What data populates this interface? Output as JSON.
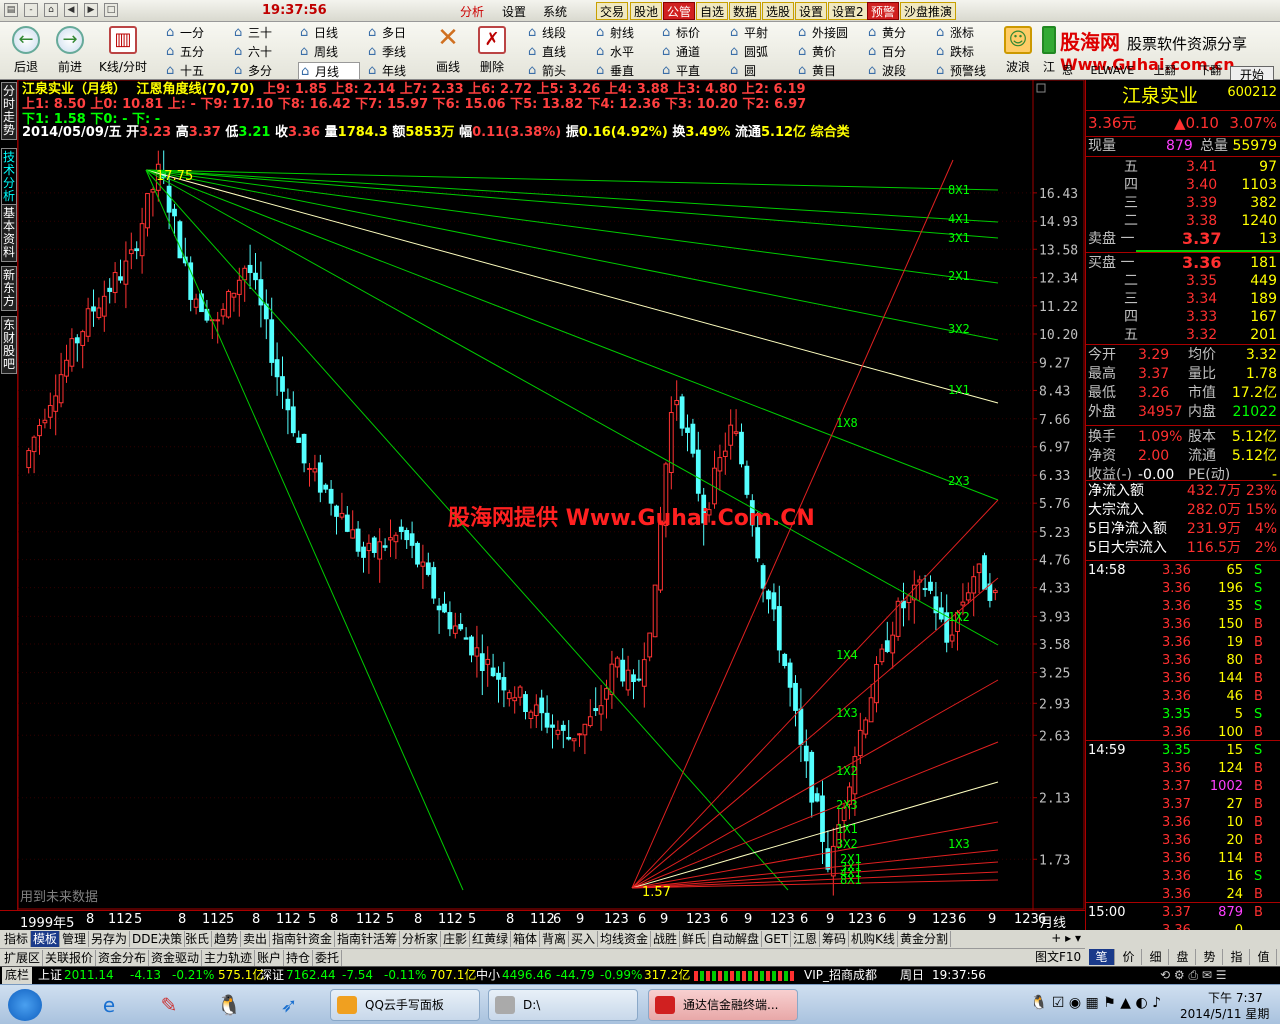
{
  "titlebar": {
    "clock": "19:37:56",
    "menus": [
      "分析",
      "设置",
      "系统"
    ],
    "buttons": [
      "交易",
      "股池",
      "公管",
      "自选",
      "数据",
      "选股",
      "设置",
      "设置2",
      "预警",
      "沙盘推演"
    ]
  },
  "toolbar": {
    "back": "后退",
    "forward": "前进",
    "kline": "K线/分时",
    "periods": [
      [
        "一分",
        "三十",
        "日线",
        "多日"
      ],
      [
        "五分",
        "六十",
        "周线",
        "季线"
      ],
      [
        "十五",
        "多分",
        "月线",
        "年线"
      ]
    ],
    "draw": "画线",
    "delete": "删除",
    "tools": [
      [
        "线段",
        "射线",
        "标价",
        "平射",
        "外接圆",
        "黄分",
        "涨标"
      ],
      [
        "直线",
        "水平",
        "通道",
        "圆弧",
        "黄价",
        "百分",
        "跌标"
      ],
      [
        "箭头",
        "垂直",
        "平直",
        "圆",
        "黄目",
        "波段",
        "预警线"
      ]
    ],
    "extra": [
      "波浪",
      "江",
      "恩",
      "ELWAVE",
      "上翻",
      "下翻"
    ],
    "logo_cn": "股海网",
    "logo_sub": "股票软件资源分享",
    "logo_url": "Www.Guhai.com.cn",
    "start": "开始"
  },
  "left_tabs": [
    "分时走势",
    "技术分析",
    "基本资料",
    "新东方",
    "东财股吧"
  ],
  "chart": {
    "title": "江泉实业（月线）",
    "indicator": "江恩角度线(70,70)",
    "up_line": "上9: 1.85 上8: 2.14 上7: 2.33 上6: 2.72 上5: 3.26 上4: 3.88 上3: 4.80 上2: 6.19",
    "line2": "上1: 8.50 上0: 10.81 上: - 下9: 17.10 下8: 16.42 下7: 15.97 下6: 15.06 下5: 13.82 下4: 12.36 下3: 10.20 下2: 6.97",
    "line3": "下1: 1.58 下0: - 下: -",
    "date": "2014/05/09/五",
    "ohlc": {
      "open_label": "开",
      "open": "3.23",
      "high_label": "高",
      "high": "3.37",
      "low_label": "低",
      "low": "3.21",
      "close_label": "收",
      "close": "3.36",
      "vol_label": "量",
      "vol": "1784.3",
      "amt_label": "额",
      "amt": "5853万",
      "chg_label": "幅",
      "chg": "0.11(3.38%)",
      "amp_label": "振",
      "amp": "0.16(4.92%)",
      "turn_label": "换",
      "turn": "3.49%",
      "float_label": "流通",
      "float": "5.12亿",
      "cat": "综合类"
    },
    "peak_label": "17.75",
    "low_label": "1.57",
    "watermark": "股海网提供 Www.Guhai.Com.CN",
    "future_note": "用到未来数据",
    "period_label": "月线",
    "y_ticks": [
      "16.43",
      "14.93",
      "13.58",
      "12.34",
      "11.22",
      "10.20",
      "9.27",
      "8.43",
      "7.66",
      "6.97",
      "6.33",
      "5.76",
      "5.23",
      "4.76",
      "4.33",
      "3.93",
      "3.58",
      "3.25",
      "2.93",
      "2.63",
      "2.13",
      "1.73"
    ],
    "x_ticks": [
      "1999年5",
      "8",
      "112",
      "5",
      "8",
      "112",
      "5",
      "8",
      "112",
      "5",
      "8",
      "112",
      "5",
      "8",
      "112",
      "5",
      "8",
      "112",
      "6",
      "9",
      "123",
      "6",
      "9",
      "123",
      "6",
      "9",
      "123",
      "6",
      "9",
      "123",
      "6",
      "9",
      "123",
      "6",
      "9",
      "123",
      "6",
      "9",
      "123"
    ],
    "fan_top_labels": [
      "8X1",
      "4X1",
      "3X1",
      "2X1",
      "3X2",
      "1X1",
      "2X3",
      "1X2"
    ],
    "fan_bottom_labels": [
      "1X8",
      "1X4",
      "1X3",
      "1X2",
      "2X3",
      "1X1",
      "3X2",
      "2X1",
      "3X1",
      "4X1",
      "8X1",
      "1X3"
    ]
  },
  "chart_data": {
    "type": "candlestick",
    "title": "江泉实业（月线）",
    "scale": "log",
    "ylim": [
      1.57,
      17.75
    ],
    "peak": 17.75,
    "trough": 1.57,
    "last": {
      "date": "2014/05/09",
      "open": 3.23,
      "high": 3.37,
      "low": 3.21,
      "close": 3.36
    }
  },
  "rpanel": {
    "name": "江泉实业",
    "code": "600212",
    "price": "3.36元",
    "chg": "▲0.10",
    "pct": "3.07%",
    "cur_label": "现量",
    "cur_vol": "879",
    "total_label": "总量",
    "total": "55979",
    "asks": [
      [
        "五",
        "3.41",
        "97"
      ],
      [
        "四",
        "3.40",
        "1103"
      ],
      [
        "三",
        "3.39",
        "382"
      ],
      [
        "二",
        "3.38",
        "1240"
      ],
      [
        "卖盘 一",
        "3.37",
        "13"
      ]
    ],
    "bids": [
      [
        "买盘 一",
        "3.36",
        "181"
      ],
      [
        "二",
        "3.35",
        "449"
      ],
      [
        "三",
        "3.34",
        "189"
      ],
      [
        "四",
        "3.33",
        "167"
      ],
      [
        "五",
        "3.32",
        "201"
      ]
    ],
    "stats": [
      [
        "今开",
        "3.29",
        "均价",
        "3.32"
      ],
      [
        "最高",
        "3.37",
        "量比",
        "1.78"
      ],
      [
        "最低",
        "3.26",
        "市值",
        "17.2亿"
      ],
      [
        "外盘",
        "34957",
        "内盘",
        "21022"
      ],
      [
        "换手",
        "1.09%",
        "股本",
        "5.12亿"
      ],
      [
        "净资",
        "2.00",
        "流通",
        "5.12亿"
      ],
      [
        "收益(-)",
        "-0.00",
        "PE(动)",
        "-"
      ]
    ],
    "flows": [
      [
        "净流入额",
        "432.7万",
        "23%"
      ],
      [
        "大宗流入",
        "282.0万",
        "15%"
      ],
      [
        "5日净流入额",
        "231.9万",
        "4%"
      ],
      [
        "5日大宗流入",
        "116.5万",
        "2%"
      ]
    ],
    "ticks": [
      [
        "14:58",
        "3.36",
        "65",
        "S"
      ],
      [
        "",
        "3.36",
        "196",
        "S"
      ],
      [
        "",
        "3.36",
        "35",
        "S"
      ],
      [
        "",
        "3.36",
        "150",
        "B"
      ],
      [
        "",
        "3.36",
        "19",
        "B"
      ],
      [
        "",
        "3.36",
        "80",
        "B"
      ],
      [
        "",
        "3.36",
        "144",
        "B"
      ],
      [
        "",
        "3.36",
        "46",
        "B"
      ],
      [
        "",
        "3.35",
        "5",
        "S"
      ],
      [
        "",
        "3.36",
        "100",
        "B"
      ],
      [
        "14:59",
        "3.35",
        "15",
        "S"
      ],
      [
        "",
        "3.36",
        "124",
        "B"
      ],
      [
        "",
        "3.37",
        "1002",
        "B"
      ],
      [
        "",
        "3.37",
        "27",
        "B"
      ],
      [
        "",
        "3.36",
        "10",
        "B"
      ],
      [
        "",
        "3.36",
        "20",
        "B"
      ],
      [
        "",
        "3.36",
        "114",
        "B"
      ],
      [
        "",
        "3.36",
        "16",
        "S"
      ],
      [
        "",
        "3.36",
        "24",
        "B"
      ],
      [
        "15:00",
        "3.37",
        "879",
        "B"
      ],
      [
        "",
        "3.36",
        "0",
        ""
      ]
    ],
    "btabs": [
      "笔",
      "价",
      "细",
      "盘",
      "势",
      "指",
      "值"
    ],
    "graph_btn": "图文F10"
  },
  "bottom_tabs1": [
    "指标",
    "模板",
    "管理",
    "另存为",
    "DDE决策",
    "张氏",
    "趋势",
    "卖出",
    "指南针资金",
    "指南针活筹",
    "分析家",
    "庄影",
    "红黄绿",
    "箱体",
    "背离",
    "买入",
    "均线资金",
    "战胜",
    "鲜氏",
    "自动解盘",
    "GET",
    "江恩",
    "筹码",
    "机购K线",
    "黄金分割"
  ],
  "bottom_tabs2": [
    "扩展区",
    "关联报价",
    "资金分布",
    "资金驱动",
    "主力轨迹",
    "账户",
    "持仓",
    "委托"
  ],
  "status": {
    "sh_label": "上证",
    "sh": "2011.14",
    "sh_chg": "-4.13",
    "sh_pct": "-0.21%",
    "sh_amt": "575.1亿",
    "sz_label": "深证",
    "sz": "7162.44",
    "sz_chg": "-7.54",
    "sz_pct": "-0.11%",
    "sz_amt": "707.1亿",
    "zx_label": "中小",
    "zx": "4496.46",
    "zx_chg": "-44.79",
    "zx_pct": "-0.99%",
    "zx_amt": "317.2亿",
    "vip": "VIP_招商成都",
    "week": "周日",
    "time": "19:37:56",
    "ticker": "底栏"
  },
  "taskbar": {
    "win1": "QQ云手写面板",
    "win2": "D:\\",
    "win3": "通达信金融终端...",
    "clock": "下午 7:37",
    "date": "2014/5/11 星期日"
  }
}
